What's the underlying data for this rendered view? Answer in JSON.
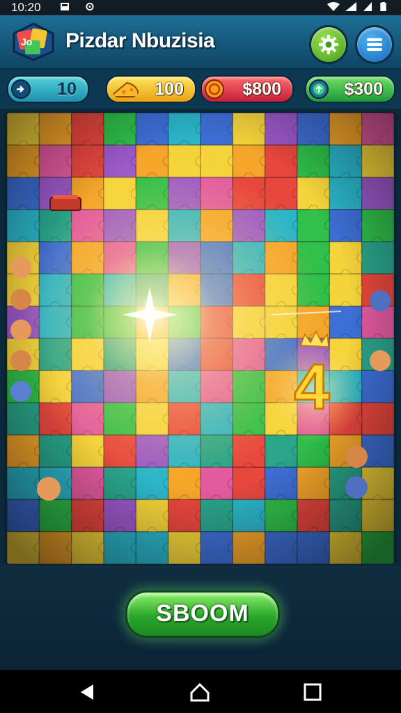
{
  "status_bar": {
    "time": "10:20"
  },
  "app": {
    "title": "Pizdar Nbuzisia"
  },
  "header": {
    "settings_icon": "gear-icon",
    "menu_icon": "hamburger-menu-icon"
  },
  "resources": [
    {
      "icon": "moves-icon",
      "value": "10",
      "color": "#2aa7c4"
    },
    {
      "icon": "cheese-icon",
      "value": "100",
      "color": "#f2b927"
    },
    {
      "icon": "coin-icon",
      "value": "$800",
      "color": "#e0394a"
    },
    {
      "icon": "gem-icon",
      "value": "$300",
      "color": "#32b54a"
    }
  ],
  "board": {
    "combo_number": "4",
    "piece_colors": [
      "#2fbf4a",
      "#f4a52a",
      "#2bb5c9",
      "#e8473e",
      "#f5d43b",
      "#3e6fd6",
      "#9c59c9",
      "#2aa58a",
      "#e35aa0"
    ]
  },
  "action_button": {
    "label": "SBOOM"
  },
  "navbar": {
    "back_icon": "back-triangle-icon",
    "home_icon": "home-icon",
    "recents_icon": "recents-square-icon"
  }
}
